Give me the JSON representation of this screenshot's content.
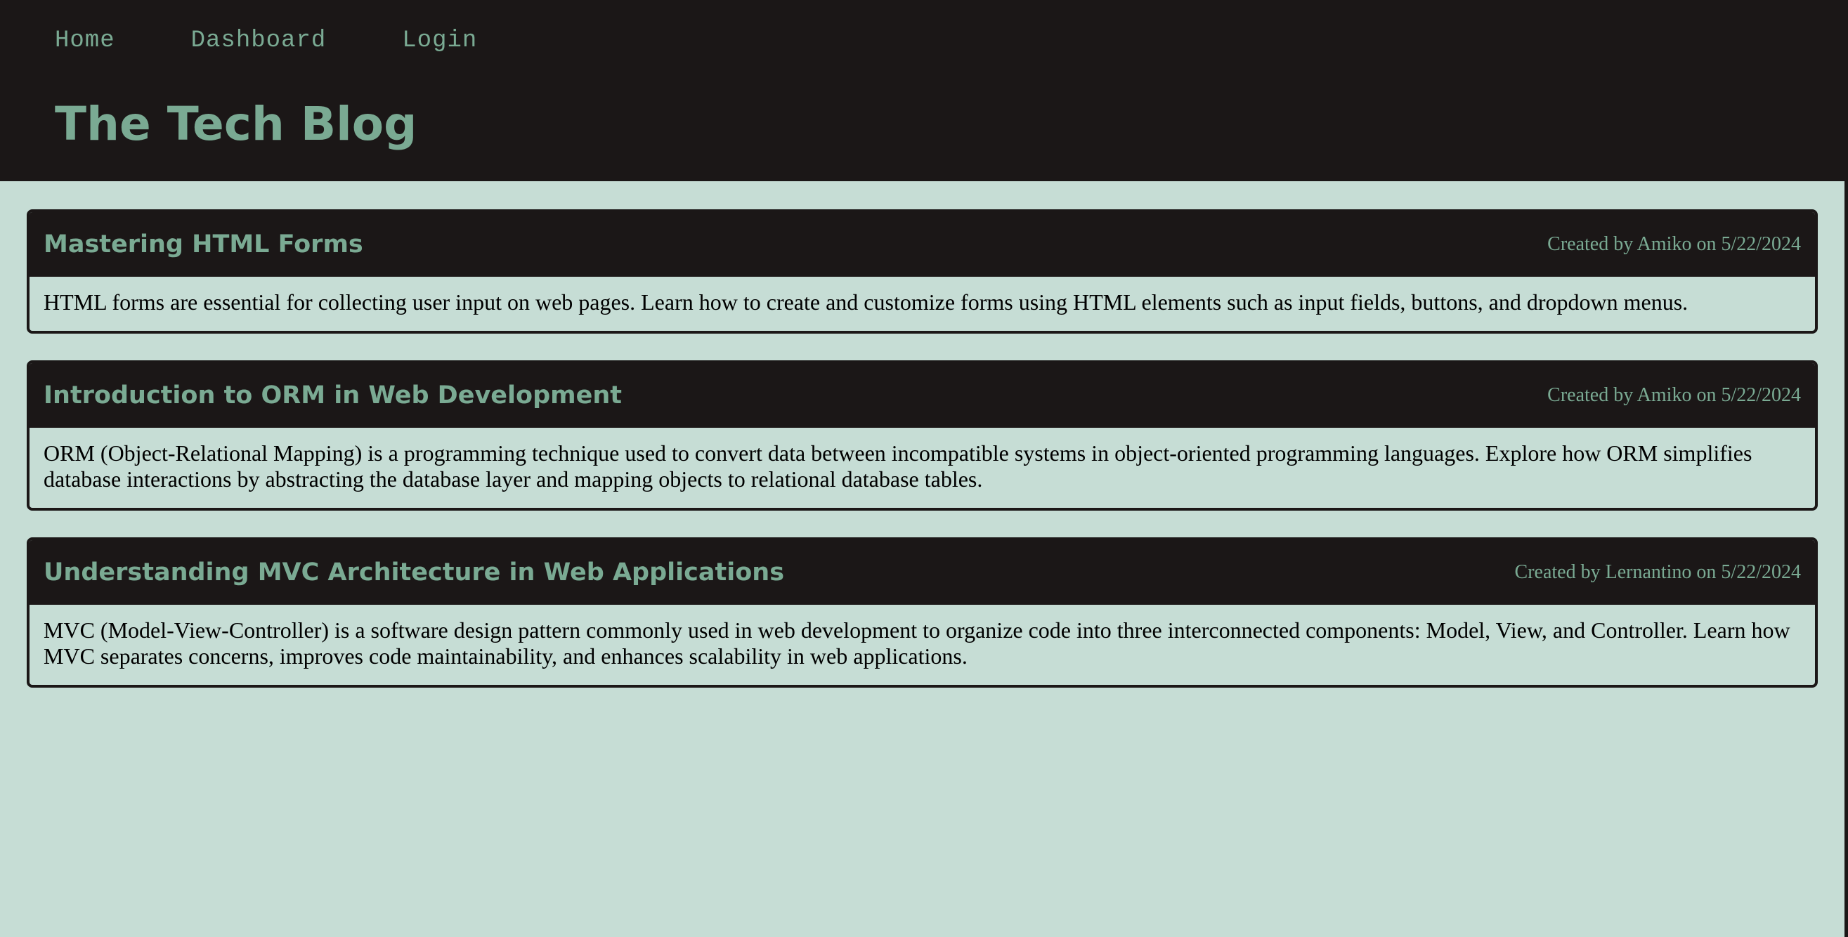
{
  "nav": {
    "home": "Home",
    "dashboard": "Dashboard",
    "login": "Login"
  },
  "site": {
    "title": "The Tech Blog"
  },
  "posts": [
    {
      "title": "Mastering HTML Forms",
      "meta": "Created by Amiko on 5/22/2024",
      "body": "HTML forms are essential for collecting user input on web pages. Learn how to create and customize forms using HTML elements such as input fields, buttons, and dropdown menus."
    },
    {
      "title": "Introduction to ORM in Web Development",
      "meta": "Created by Amiko on 5/22/2024",
      "body": "ORM (Object-Relational Mapping) is a programming technique used to convert data between incompatible systems in object-oriented programming languages. Explore how ORM simplifies database interactions by abstracting the database layer and mapping objects to relational database tables."
    },
    {
      "title": "Understanding MVC Architecture in Web Applications",
      "meta": "Created by Lernantino on 5/22/2024",
      "body": "MVC (Model-View-Controller) is a software design pattern commonly used in web development to organize code into three interconnected components: Model, View, and Controller. Learn how MVC separates concerns, improves code maintainability, and enhances scalability in web applications."
    }
  ],
  "colors": {
    "header_bg": "#1b1717",
    "accent": "#7aaa93",
    "page_bg": "#c6ddd5",
    "body_text": "#000000"
  }
}
